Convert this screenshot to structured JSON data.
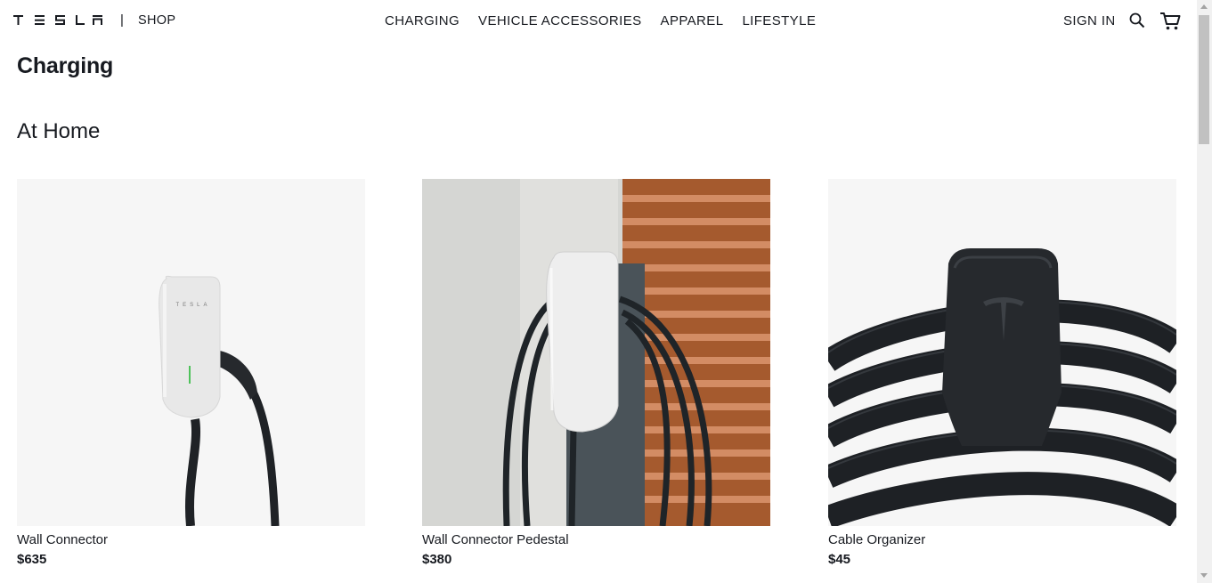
{
  "header": {
    "brand_name": "TESLA",
    "separator": "|",
    "shop_label": "SHOP",
    "nav": [
      "CHARGING",
      "VEHICLE ACCESSORIES",
      "APPAREL",
      "LIFESTYLE"
    ],
    "sign_in_label": "SIGN IN",
    "icons": [
      "search-icon",
      "cart-icon"
    ]
  },
  "page": {
    "title": "Charging",
    "section_title": "At Home"
  },
  "products": [
    {
      "name": "Wall Connector",
      "price": "$635",
      "image": "wall-connector-image"
    },
    {
      "name": "Wall Connector Pedestal",
      "price": "$380",
      "image": "wall-connector-pedestal-image"
    },
    {
      "name": "Cable Organizer",
      "price": "$45",
      "image": "cable-organizer-image"
    }
  ],
  "colors": {
    "text": "#171a20",
    "image_background": "#f6f6f6",
    "charger_white": "#e6e6e6",
    "cable_black": "#1f2226"
  }
}
